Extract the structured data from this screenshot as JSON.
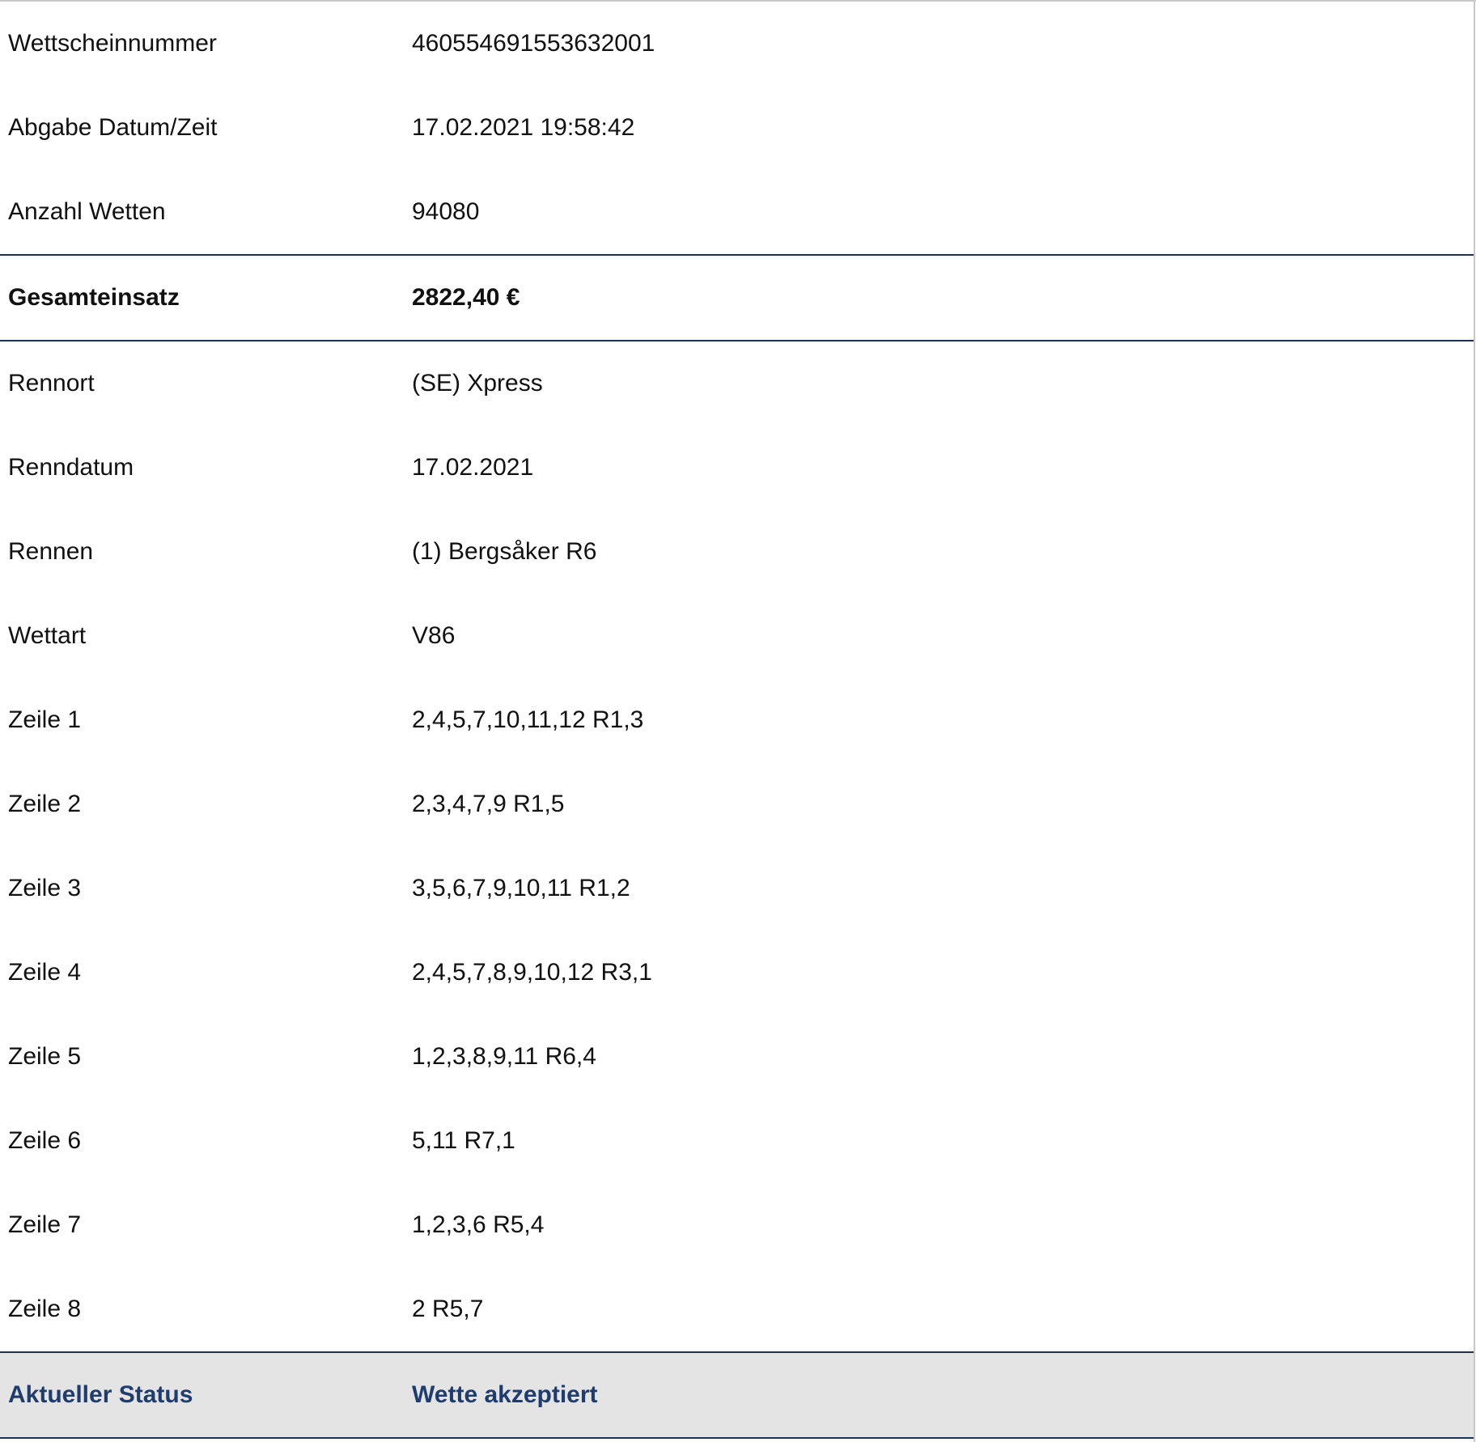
{
  "bet_details": {
    "rows_top": [
      {
        "label": "Wettscheinnummer",
        "value": "460554691553632001"
      },
      {
        "label": "Abgabe Datum/Zeit",
        "value": "17.02.2021 19:58:42"
      },
      {
        "label": "Anzahl Wetten",
        "value": "94080"
      }
    ],
    "total": {
      "label": "Gesamteinsatz",
      "value": "2822,40 €"
    },
    "rows_race": [
      {
        "label": "Rennort",
        "value": "(SE) Xpress"
      },
      {
        "label": "Renndatum",
        "value": "17.02.2021"
      },
      {
        "label": "Rennen",
        "value": "(1) Bergsåker R6"
      },
      {
        "label": "Wettart",
        "value": "V86"
      },
      {
        "label": "Zeile 1",
        "value": "2,4,5,7,10,11,12 R1,3"
      },
      {
        "label": "Zeile 2",
        "value": "2,3,4,7,9 R1,5"
      },
      {
        "label": "Zeile 3",
        "value": "3,5,6,7,9,10,11 R1,2"
      },
      {
        "label": "Zeile 4",
        "value": "2,4,5,7,8,9,10,12 R3,1"
      },
      {
        "label": "Zeile 5",
        "value": "1,2,3,8,9,11 R6,4"
      },
      {
        "label": "Zeile 6",
        "value": "5,11 R7,1"
      },
      {
        "label": "Zeile 7",
        "value": "1,2,3,6 R5,4"
      },
      {
        "label": "Zeile 8",
        "value": "2 R5,7"
      }
    ],
    "status": {
      "label": "Aktueller Status",
      "value": "Wette akzeptiert"
    }
  }
}
